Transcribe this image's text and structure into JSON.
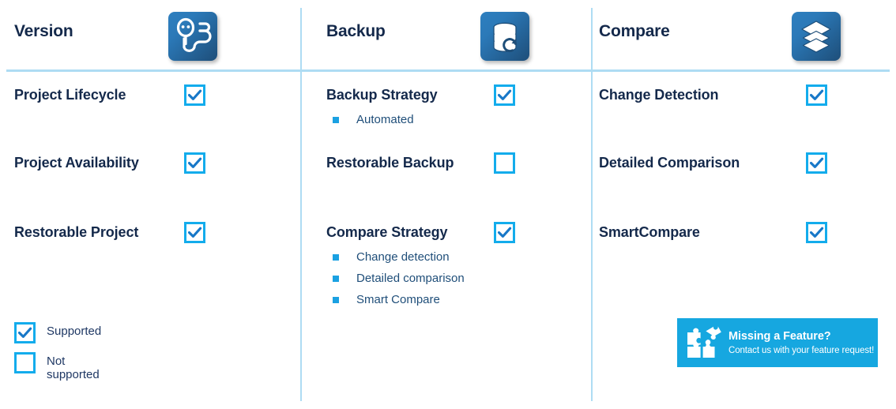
{
  "theme": {
    "heading_color": "#14294B",
    "accent_blue": "#13ACEC",
    "divider_color": "#AEDCF3",
    "bullet_color": "#1BA1E2",
    "banner_bg": "#16A7E0",
    "icon_gradient_from": "#2E7FBF",
    "icon_gradient_to": "#1E4E79"
  },
  "columns": [
    {
      "title": "Version",
      "icon": "version-branch-icon",
      "features": [
        {
          "label": "Project Lifecycle",
          "supported": true,
          "checkbox_state": "checked",
          "subitems": []
        },
        {
          "label": "Project Availability",
          "supported": true,
          "checkbox_state": "checked",
          "subitems": []
        },
        {
          "label": "Restorable Project",
          "supported": true,
          "checkbox_state": "checked",
          "subitems": []
        }
      ]
    },
    {
      "title": "Backup",
      "icon": "database-restore-icon",
      "features": [
        {
          "label": "Backup Strategy",
          "supported": true,
          "checkbox_state": "checked",
          "subitems": [
            "Automated"
          ]
        },
        {
          "label": "Restorable Backup",
          "supported": false,
          "checkbox_state": "unchecked",
          "subitems": []
        },
        {
          "label": "Compare Strategy",
          "supported": true,
          "checkbox_state": "checked",
          "subitems": [
            "Change detection",
            "Detailed comparison",
            "Smart Compare"
          ]
        }
      ]
    },
    {
      "title": "Compare",
      "icon": "layers-stack-icon",
      "features": [
        {
          "label": "Change Detection",
          "supported": true,
          "checkbox_state": "checked",
          "subitems": []
        },
        {
          "label": "Detailed Comparison",
          "supported": true,
          "checkbox_state": "checked",
          "subitems": []
        },
        {
          "label": "SmartCompare",
          "supported": true,
          "checkbox_state": "checked",
          "subitems": []
        }
      ]
    }
  ],
  "legend": {
    "supported_label": "Supported",
    "not_supported_label": "Not supported"
  },
  "banner": {
    "title": "Missing a Feature?",
    "subtitle": "Contact us with your feature request!",
    "icon": "puzzle-pieces-icon"
  }
}
